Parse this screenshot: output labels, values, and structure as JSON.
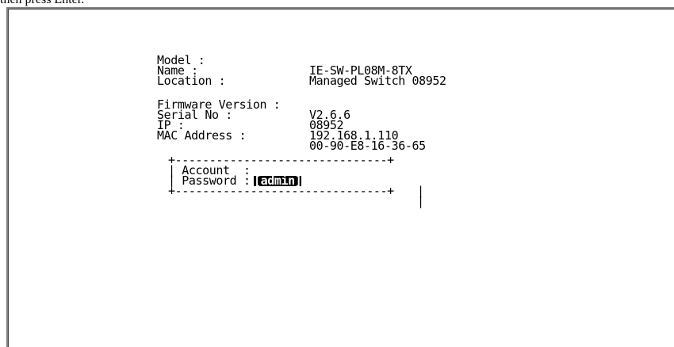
{
  "caption": "then press Enter.",
  "info": {
    "model_label": "Model :",
    "model_value": "IE-SW-PL08M-8TX",
    "name_label": "Name :",
    "name_value": "Managed Switch 08952",
    "location_label": "Location :",
    "location_value": "",
    "firmware_label": "Firmware Version :",
    "firmware_value": "V2.6.6",
    "serial_label": "Serial No :",
    "serial_value": "08952",
    "ip_label": "IP :",
    "ip_value": "192.168.1.110",
    "mac_label": "MAC Address :",
    "mac_value": "00-90-E8-16-36-65"
  },
  "login": {
    "border_top": "+-------------------------------+",
    "border_bottom": "+-------------------------------+",
    "account_label": "| Account  : ",
    "account_value": "[admin]",
    "password_label": "| Password :",
    "right_edge": "|"
  }
}
